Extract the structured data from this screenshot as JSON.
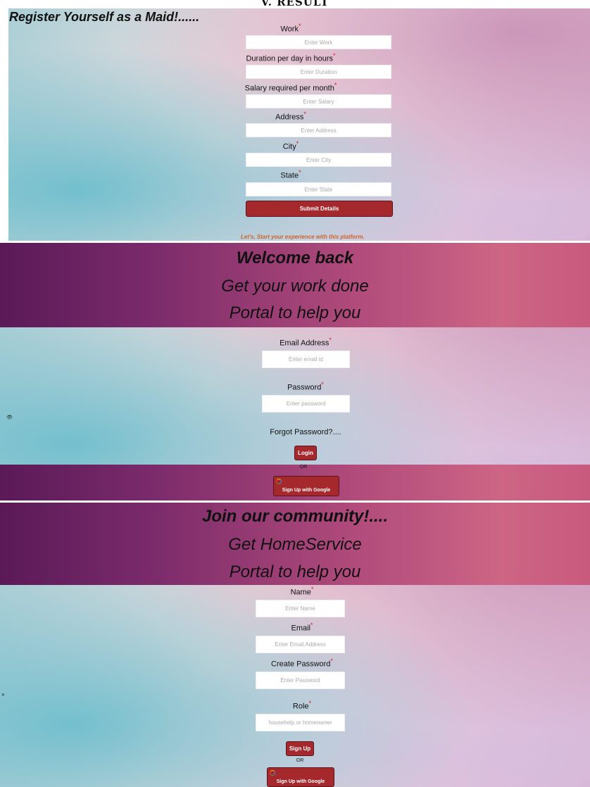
{
  "page_heading": "V.   RESULT",
  "maid_form": {
    "title": "Register Yourself as a Maid!......",
    "fields": [
      {
        "label": "Work",
        "placeholder": "Enter Work"
      },
      {
        "label": "Duration per day in hours",
        "placeholder": "Enter Duration"
      },
      {
        "label": "Salary required per month",
        "placeholder": "Enter Salary"
      },
      {
        "label": "Address",
        "placeholder": "Enter Address"
      },
      {
        "label": "City",
        "placeholder": "Enter City"
      },
      {
        "label": "State",
        "placeholder": "Enter State"
      }
    ],
    "required_mark": "*",
    "submit_label": "Submit Details",
    "footer_text": "Let's, Start your experience with this platform."
  },
  "login": {
    "heading_bold": "Welcome back",
    "heading_line2": "Get your work done",
    "heading_line3": "Portal to help you",
    "email_label": "Email Address",
    "email_placeholder": "Enter email id",
    "password_label": "Password",
    "password_placeholder": "Enter password",
    "forgot_label": "Forgot Password?....",
    "login_label": "Login",
    "or_label": "OR",
    "google_label": "Sign Up with Google",
    "eye_glyph": "👁"
  },
  "signup": {
    "heading_bold": "Join our community!....",
    "heading_line2": "Get HomeService",
    "heading_line3": "Portal to help you",
    "name_label": "Name",
    "name_placeholder": "Enter Name",
    "email_label": "Email",
    "email_placeholder": "Enter Email Address",
    "password_label": "Create Password",
    "password_placeholder": "Enter Password",
    "role_label": "Role",
    "role_placeholder": "househelp or homeowner",
    "signup_label": "Sign Up",
    "or_label": "OR",
    "google_label": "Sign Up with Google",
    "eye_glyph": "»"
  }
}
